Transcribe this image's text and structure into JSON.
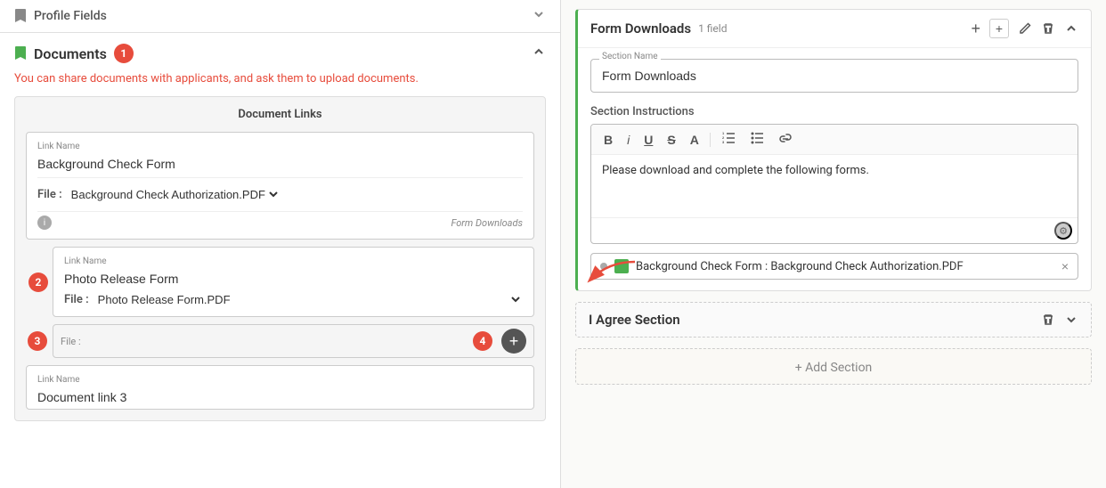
{
  "leftPanel": {
    "profileFields": {
      "title": "Profile Fields",
      "chevronIcon": "chevron-down"
    },
    "documents": {
      "title": "Documents",
      "badgeNumber": "1",
      "infoText": "You can share documents with applicants, and ask them to upload documents.",
      "docLinksTitle": "Document Links",
      "links": [
        {
          "linkNameLabel": "Link Name",
          "linkNameValue": "Background Check Form",
          "fileLabel": "File :",
          "fileValue": "Background Check Authorization.PDF",
          "footerTag": "Form Downloads",
          "badge": null
        },
        {
          "linkNameLabel": "Link Name",
          "linkNameValue": "Photo Release Form",
          "fileLabel": "File :",
          "fileValue": "Photo Release Form.PDF",
          "footerTag": "",
          "badge": "2"
        }
      ],
      "partialLink": {
        "linkNameLabel": "Link Name",
        "linkNameValue": "Document link 3"
      },
      "addBadge": "4",
      "addBtnLabel": "+"
    }
  },
  "rightPanel": {
    "formSection": {
      "title": "Form Downloads",
      "fieldCount": "1 field",
      "sectionNameLabel": "Section Name",
      "sectionNameValue": "Form Downloads",
      "instructionsLabel": "Section Instructions",
      "instructionsText": "Please download and complete the following forms.",
      "toolbar": {
        "bold": "B",
        "italic": "i",
        "underline": "U",
        "strikethrough": "S",
        "fontSize": "A",
        "orderedList": "≡",
        "unorderedList": "≡",
        "link": "🔗"
      },
      "downloadField": {
        "dotColor": "#aaa",
        "greenSquare": true,
        "text": "Background Check Form : Background Check Authorization.PDF",
        "closeBtn": "×"
      },
      "actions": {
        "addFieldIcon": "+",
        "addFieldAltIcon": "+",
        "editIcon": "✏",
        "deleteIcon": "🗑",
        "collapseIcon": "∧"
      }
    },
    "agreeSection": {
      "title": "I Agree Section",
      "deleteIcon": "🗑",
      "collapseIcon": "∨"
    },
    "addSection": {
      "label": "+ Add Section"
    }
  }
}
